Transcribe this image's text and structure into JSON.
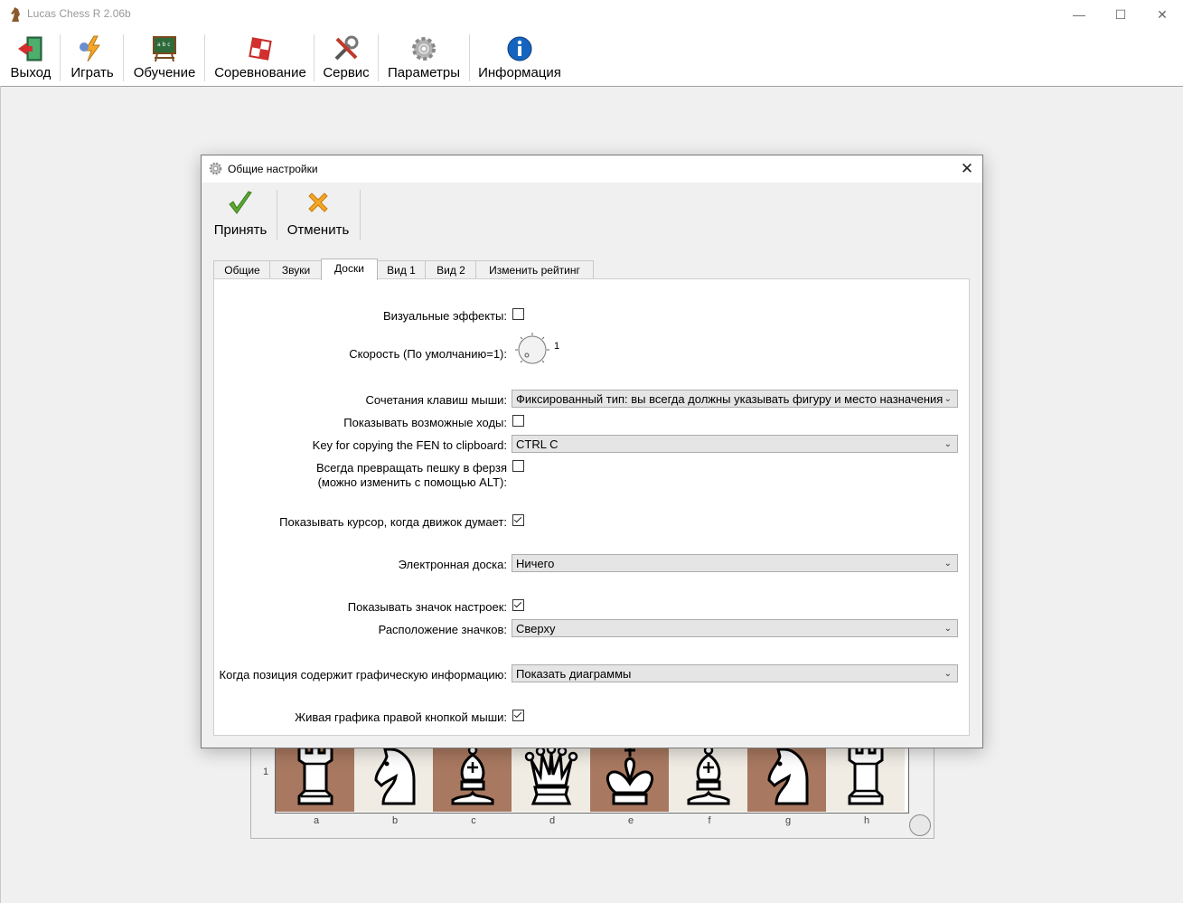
{
  "window": {
    "title": "Lucas Chess R 2.06b"
  },
  "toolbar": {
    "items": [
      {
        "label": "Выход",
        "icon": "exit-door-icon"
      },
      {
        "label": "Играть",
        "icon": "play-lightning-icon"
      },
      {
        "label": "Обучение",
        "icon": "blackboard-icon"
      },
      {
        "label": "Соревнование",
        "icon": "competition-board-icon"
      },
      {
        "label": "Сервис",
        "icon": "tools-icon"
      },
      {
        "label": "Параметры",
        "icon": "gear-icon"
      },
      {
        "label": "Информация",
        "icon": "info-icon"
      }
    ]
  },
  "board": {
    "rank": "1",
    "files": [
      "a",
      "b",
      "c",
      "d",
      "e",
      "f",
      "g",
      "h"
    ],
    "pieces": [
      "rook",
      "knight",
      "bishop",
      "queen",
      "king",
      "bishop",
      "knight",
      "rook"
    ]
  },
  "dialog": {
    "title": "Общие настройки",
    "accept_label": "Принять",
    "cancel_label": "Отменить",
    "tabs": [
      "Общие",
      "Звуки",
      "Доски",
      "Вид 1",
      "Вид 2",
      "Изменить рейтинг"
    ],
    "active_tab": "Доски",
    "fields": {
      "visual_effects": {
        "label": "Визуальные эффекты:",
        "checked": false
      },
      "speed": {
        "label": "Скорость (По умолчанию=1):",
        "value": "1"
      },
      "mouse_shortcuts": {
        "label": "Сочетания клавиш мыши:",
        "value": "Фиксированный тип: вы всегда должны указывать фигуру и место назначения"
      },
      "show_moves": {
        "label": "Показывать возможные ходы:",
        "checked": false
      },
      "fen_key": {
        "label": "Key for copying the FEN to clipboard:",
        "value": "CTRL C"
      },
      "promote_queen": {
        "label_line1": "Всегда превращать пешку в ферзя",
        "label_line2": "(можно изменить с помощью ALT):",
        "checked": false
      },
      "show_cursor": {
        "label": "Показывать курсор, когда движок думает:",
        "checked": true
      },
      "eboard": {
        "label": "Электронная доска:",
        "value": "Ничего"
      },
      "show_settings_icon": {
        "label": "Показывать значок настроек:",
        "checked": true
      },
      "icons_position": {
        "label": "Расположение значков:",
        "value": "Сверху"
      },
      "graphic_info": {
        "label": "Когда позиция содержит графическую информацию:",
        "value": "Показать диаграммы"
      },
      "live_graphics": {
        "label": "Живая графика правой кнопкой мыши:",
        "checked": true
      }
    }
  }
}
